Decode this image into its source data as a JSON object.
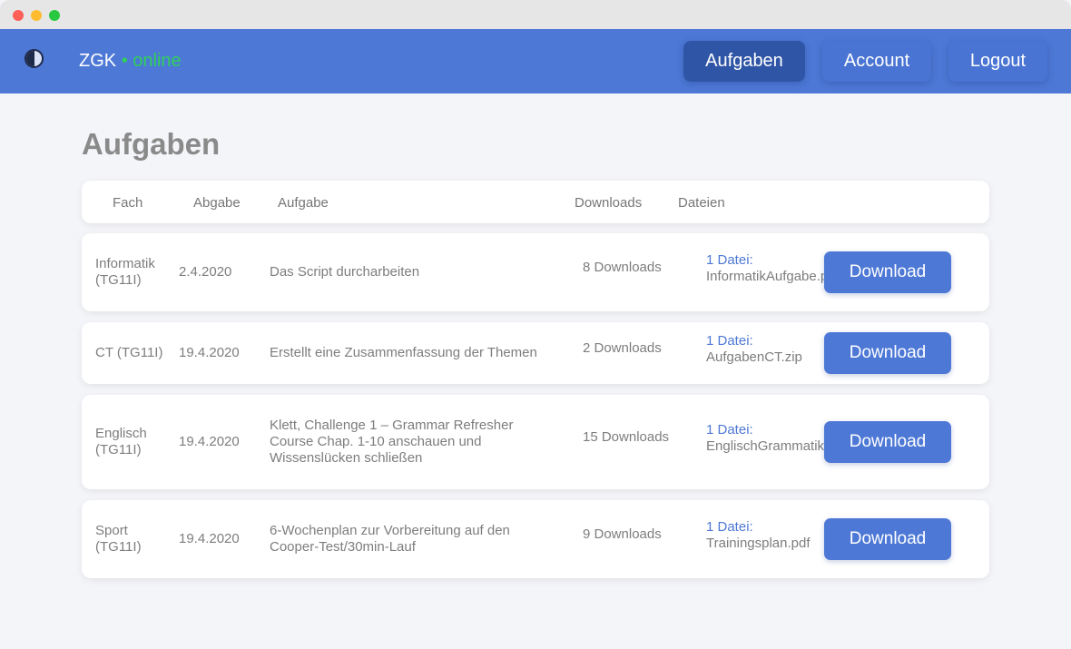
{
  "navbar": {
    "brand_name": "ZGK",
    "brand_separator": "•",
    "brand_suffix": "online",
    "logo_icon": "contrast-icon",
    "links": {
      "aufgaben": "Aufgaben",
      "account": "Account",
      "logout": "Logout"
    }
  },
  "page": {
    "title": "Aufgaben"
  },
  "table": {
    "headers": {
      "fach": "Fach",
      "abgabe": "Abgabe",
      "aufgabe": "Aufgabe",
      "downloads": "Downloads",
      "dateien": "Dateien"
    },
    "rows": [
      {
        "fach": "Informatik (TG11I)",
        "abgabe": "2.4.2020",
        "aufgabe": "Das Script durcharbeiten",
        "downloads": "8 Downloads",
        "files_label": "1 Datei:",
        "file_name": "InformatikAufgabe.pdf",
        "button": "Download"
      },
      {
        "fach": "CT (TG11I)",
        "abgabe": "19.4.2020",
        "aufgabe": "Erstellt eine Zusammenfassung der Themen",
        "downloads": "2 Downloads",
        "files_label": "1 Datei:",
        "file_name": "AufgabenCT.zip",
        "button": "Download"
      },
      {
        "fach": "Englisch (TG11I)",
        "abgabe": "19.4.2020",
        "aufgabe": "Klett, Challenge 1 – Grammar Refresher Course Chap. 1-10 anschauen und Wissenslücken schließen",
        "downloads": "15 Downloads",
        "files_label": "1 Datei:",
        "file_name": "EnglischGrammatik.pdf",
        "button": "Download"
      },
      {
        "fach": "Sport (TG11I)",
        "abgabe": "19.4.2020",
        "aufgabe": "6-Wochenplan zur Vorbereitung auf den Cooper-Test/30min-Lauf",
        "downloads": "9 Downloads",
        "files_label": "1 Datei:",
        "file_name": "Trainingsplan.pdf",
        "button": "Download"
      }
    ]
  },
  "colors": {
    "navbar": "#4d78d6",
    "nav_active": "#2f55a6",
    "accent_online": "#2fcf5a",
    "button": "#4d78d6",
    "background": "#f4f5f9"
  }
}
